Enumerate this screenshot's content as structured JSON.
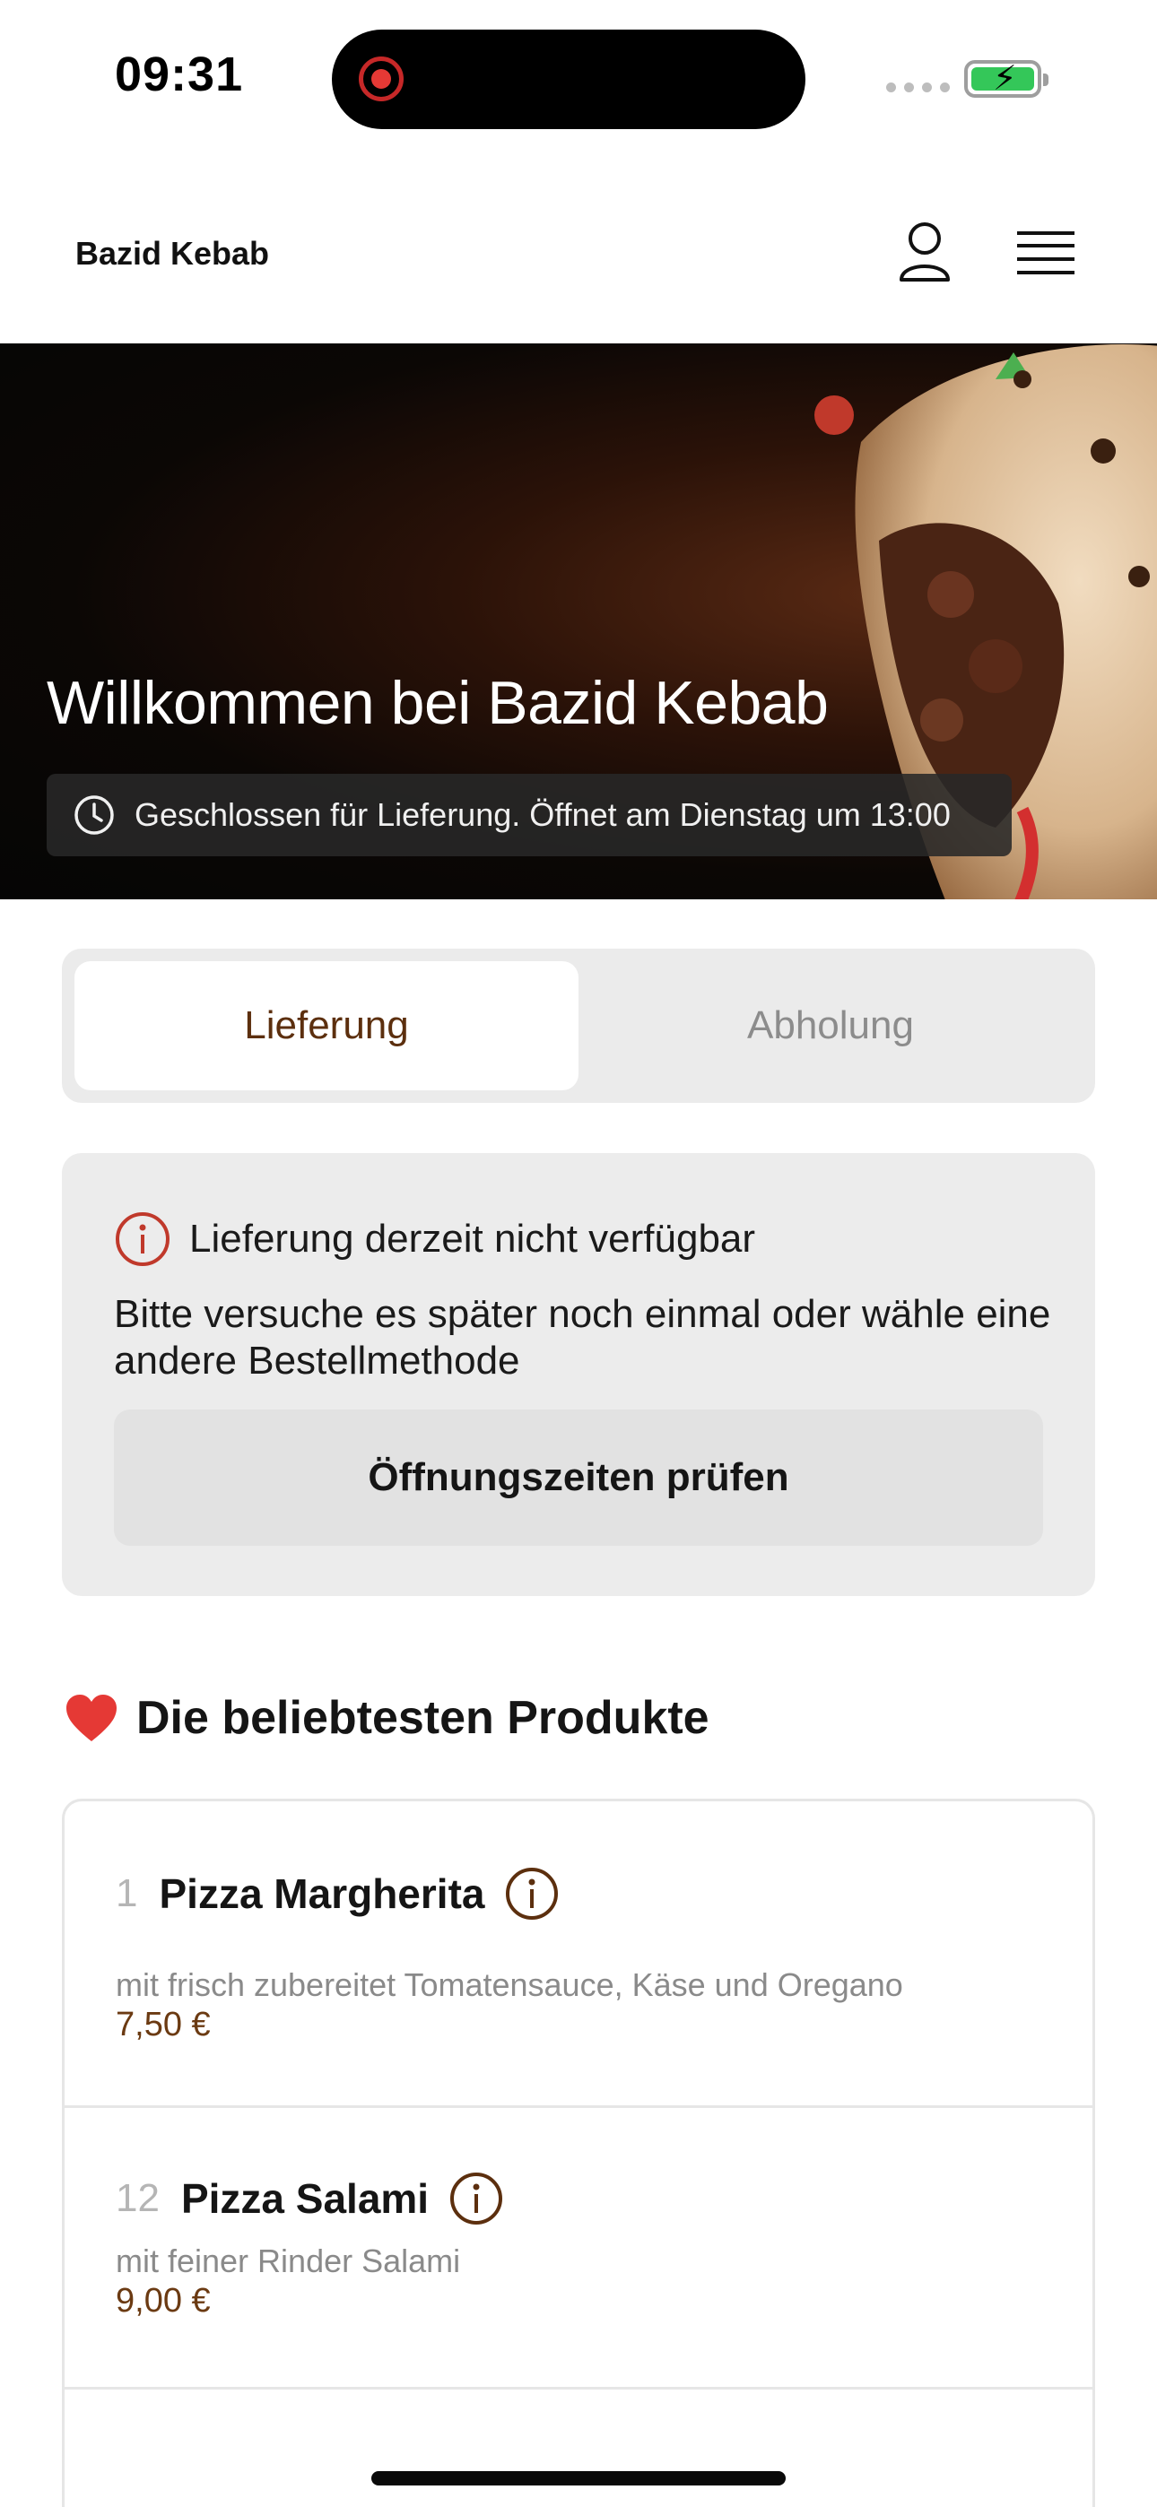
{
  "status_bar": {
    "time": "09:31",
    "battery_color": "#34c759"
  },
  "header": {
    "brand": "Bazid Kebab",
    "icons": [
      "user-icon",
      "menu-icon"
    ]
  },
  "hero": {
    "title": "Willkommen bei Bazid Kebab",
    "notice": "Geschlossen für Lieferung. Öffnet am Dienstag um 13:00",
    "icon": "clock-icon"
  },
  "tabs": [
    {
      "label": "Lieferung",
      "active": true
    },
    {
      "label": "Abholung",
      "active": false
    }
  ],
  "delivery_notice": {
    "icon": "info-icon",
    "heading": "Lieferung derzeit nicht verfügbar",
    "body": "Bitte versuche es später noch einmal oder wähle eine andere Bestellmethode",
    "button": "Öffnungszeiten prüfen"
  },
  "popular": {
    "icon": "heart-icon",
    "title": "Die beliebtesten Produkte",
    "products": [
      {
        "number": "1",
        "name": "Pizza Margherita",
        "description": "mit frisch zubereitet Tomatensauce, Käse und Oregano",
        "price": "7,50 €"
      },
      {
        "number": "12",
        "name": "Pizza Salami",
        "description": "mit feiner Rinder Salami",
        "price": "9,00 €"
      }
    ]
  },
  "colors": {
    "accent": "#5c2f0e",
    "price": "#6b3a12",
    "alert": "#c0392b",
    "heart": "#e53935"
  }
}
